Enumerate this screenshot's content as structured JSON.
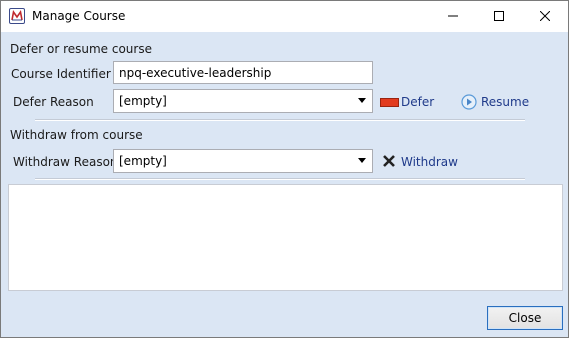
{
  "window": {
    "title": "Manage Course"
  },
  "defer_section": {
    "heading": "Defer or resume course",
    "course_identifier_label": "Course Identifier",
    "course_identifier_value": "npq-executive-leadership",
    "defer_reason_label": "Defer Reason",
    "defer_reason_value": "[empty]",
    "defer_button": "Defer",
    "resume_button": "Resume"
  },
  "withdraw_section": {
    "heading": "Withdraw from course",
    "withdraw_reason_label": "Withdraw Reason",
    "withdraw_reason_value": "[empty]",
    "withdraw_button": "Withdraw"
  },
  "footer": {
    "close_button": "Close"
  },
  "icons": {
    "app": "app-m-logo-icon",
    "defer": "red-bar-icon",
    "resume": "play-circle-icon",
    "withdraw": "x-mark-icon"
  },
  "colors": {
    "client_bg": "#dbe6f4",
    "link": "#1f3a8a",
    "defer_icon": "#e23b1f",
    "resume_icon": "#5a9ad8"
  }
}
